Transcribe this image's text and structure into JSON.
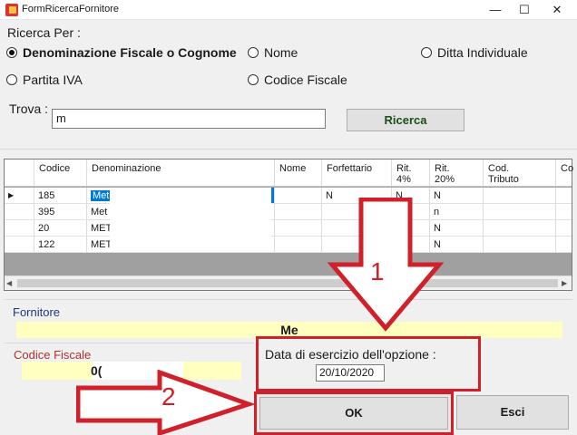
{
  "window": {
    "title": "FormRicercaFornitore",
    "minimize": "—",
    "maximize": "☐",
    "close": "✕"
  },
  "search_by": {
    "label": "Ricerca Per :",
    "options": [
      {
        "label": "Denominazione Fiscale  o Cognome",
        "checked": true
      },
      {
        "label": "Nome",
        "checked": false
      },
      {
        "label": "Ditta Individuale",
        "checked": false
      },
      {
        "label": "Partita IVA",
        "checked": false
      },
      {
        "label": "Codice Fiscale",
        "checked": false
      }
    ]
  },
  "find": {
    "label": "Trova :",
    "value": "m",
    "search_button": "Ricerca"
  },
  "grid": {
    "columns": [
      "Codice",
      "Denominazione",
      "Nome",
      "Forfettario",
      "Rit.\n4%",
      "Rit.\n20%",
      "Cod.\nTributo",
      "Co"
    ],
    "rows": [
      {
        "codice": "185",
        "denominazione": "Met",
        "nome": "",
        "forfettario": "N",
        "rit4": "N",
        "rit20": "N",
        "selected": true
      },
      {
        "codice": "395",
        "denominazione": "Met",
        "nome": "",
        "forfettario": "",
        "rit4": "",
        "rit20": "n",
        "selected": false
      },
      {
        "codice": "20",
        "denominazione": "METi",
        "nome": "",
        "forfettario": "",
        "rit4": "",
        "rit20": "N",
        "selected": false
      },
      {
        "codice": "122",
        "denominazione": "METi",
        "nome": "",
        "forfettario": "",
        "rit4": "",
        "rit20": "N",
        "selected": false
      }
    ]
  },
  "supplier": {
    "label": "Fornitore",
    "value": "Me"
  },
  "tax_code": {
    "label": "Codice Fiscale",
    "value": "0("
  },
  "option_date": {
    "label": "Data di esercizio dell'opzione :",
    "value": "20/10/2020"
  },
  "buttons": {
    "ok": "OK",
    "exit": "Esci"
  },
  "annotations": {
    "step1": "1",
    "step2": "2",
    "color": "#d0202a"
  }
}
